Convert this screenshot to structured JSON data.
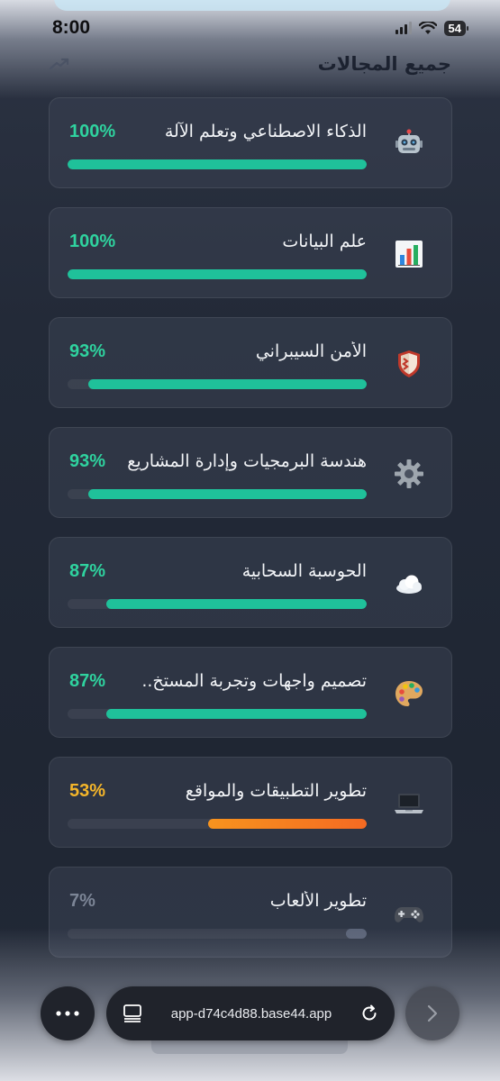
{
  "status_bar": {
    "time": "8:00",
    "battery": "54"
  },
  "section": {
    "title": "جميع المجالات",
    "icon": "trend-up-icon"
  },
  "fields": [
    {
      "name": "الذكاء الاصطناعي وتعلم الآلة",
      "percent_label": "100%",
      "progress": 1.0,
      "icon": "robot-icon",
      "color": "#1fc19a",
      "label_color": "#2fd39f"
    },
    {
      "name": "علم البيانات",
      "percent_label": "100%",
      "progress": 1.0,
      "icon": "bar-chart-icon",
      "color": "#1fc19a",
      "label_color": "#2fd39f"
    },
    {
      "name": "الأمن السيبراني",
      "percent_label": "93%",
      "progress": 0.93,
      "icon": "shield-icon",
      "color": "#1fc19a",
      "label_color": "#2fd39f"
    },
    {
      "name": "هندسة البرمجيات وإدارة المشاريع",
      "percent_label": "93%",
      "progress": 0.93,
      "icon": "gear-icon",
      "color": "#1fc19a",
      "label_color": "#2fd39f"
    },
    {
      "name": "الحوسبة السحابية",
      "percent_label": "87%",
      "progress": 0.87,
      "icon": "cloud-icon",
      "color": "#1fc19a",
      "label_color": "#2fd39f"
    },
    {
      "name": "تصميم واجهات وتجربة المستخ..",
      "percent_label": "87%",
      "progress": 0.87,
      "icon": "palette-icon",
      "color": "#1fc19a",
      "label_color": "#2fd39f"
    },
    {
      "name": "تطوير التطبيقات والمواقع",
      "percent_label": "53%",
      "progress": 0.53,
      "icon": "laptop-icon",
      "color": "#f7931e",
      "label_color": "#f5b62a"
    },
    {
      "name": "تطوير الألعاب",
      "percent_label": "7%",
      "progress": 0.07,
      "icon": "gamepad-icon",
      "color": "#5b6478",
      "label_color": "#7c8596"
    }
  ],
  "browser": {
    "url": "app-d74c4d88.base44.app"
  },
  "colors": {
    "accent_green": "#1fc19a",
    "accent_orange": "#f7931e",
    "muted": "#5b6478"
  }
}
